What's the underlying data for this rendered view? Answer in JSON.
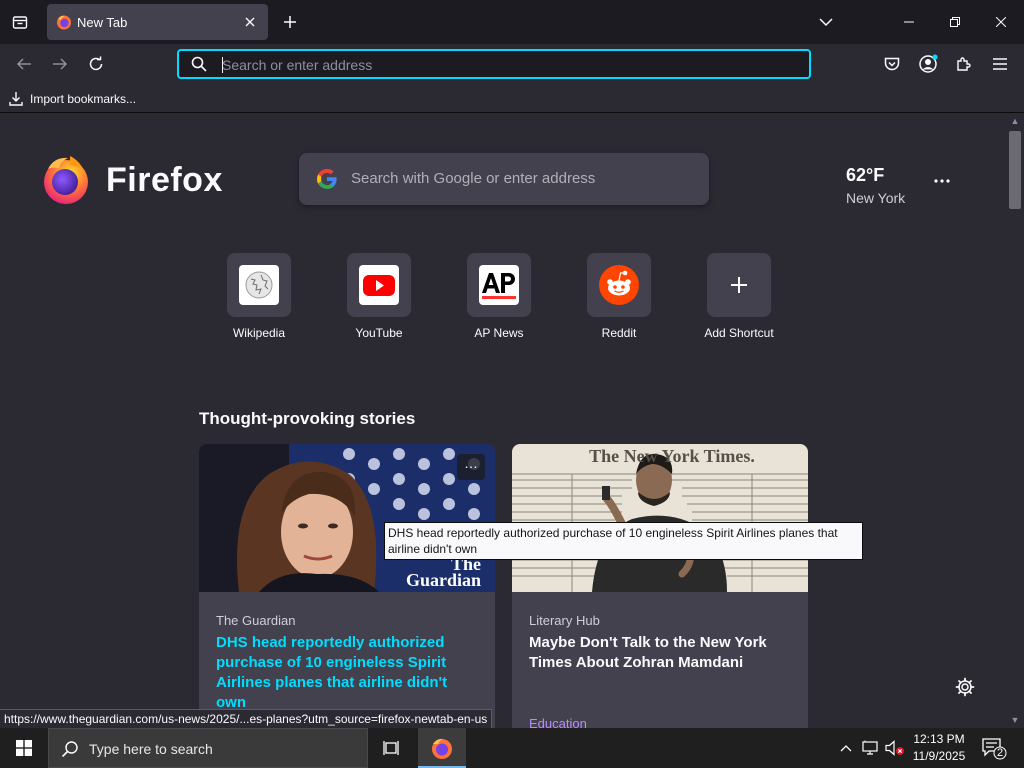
{
  "tabs": [
    {
      "title": "New Tab"
    }
  ],
  "navbar": {
    "url_placeholder": "Search or enter address"
  },
  "bookmarks_bar": {
    "items": [
      {
        "label": "Import bookmarks..."
      }
    ]
  },
  "newtab": {
    "brand": "Firefox",
    "search_placeholder": "Search with Google or enter address",
    "weather": {
      "temperature": "62°F",
      "location": "New York"
    },
    "shortcuts": [
      {
        "label": "Wikipedia"
      },
      {
        "label": "YouTube"
      },
      {
        "label": "AP News"
      },
      {
        "label": "Reddit"
      },
      {
        "label": "Add Shortcut"
      }
    ],
    "stories_heading": "Thought-provoking stories",
    "stories": [
      {
        "source": "The Guardian",
        "headline": "DHS head reportedly authorized purchase of 10 engineless Spirit Airlines planes that airline didn't own",
        "image_caption": "The Guardian",
        "category": ""
      },
      {
        "source": "Literary Hub",
        "headline": "Maybe Don't Talk to the New York Times About Zohran Mamdani",
        "image_caption": "The New York Times.",
        "category": "Education"
      }
    ],
    "tooltip": "DHS head reportedly authorized purchase of 10 engineless Spirit Airlines planes that airline didn't own"
  },
  "status_url": "https://www.theguardian.com/us-news/2025/...es-planes?utm_source=firefox-newtab-en-us",
  "taskbar": {
    "search_placeholder": "Type here to search",
    "time": "12:13 PM",
    "date": "11/9/2025",
    "notification_count": "2"
  },
  "colors": {
    "accent": "#00ddff",
    "link": "#00ddff",
    "category": "#b98bff",
    "content_bg": "#2b2a33",
    "tile_bg": "#42414d"
  }
}
